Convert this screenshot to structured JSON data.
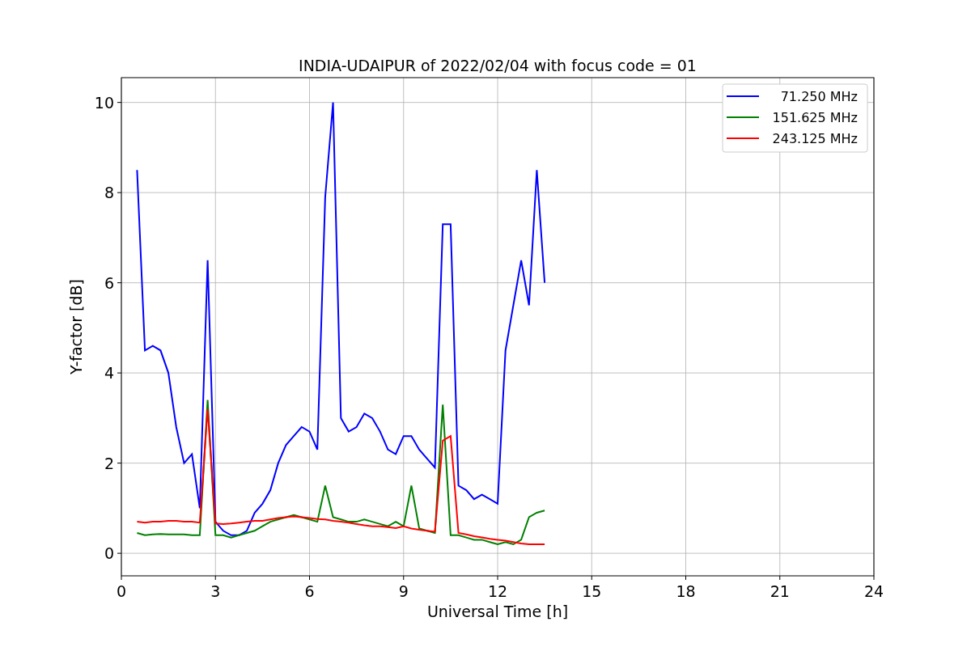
{
  "chart_data": {
    "type": "line",
    "title": "INDIA-UDAIPUR of 2022/02/04 with focus code = 01",
    "xlabel": "Universal Time [h]",
    "ylabel": "Y-factor [dB]",
    "x": [
      0.5,
      0.75,
      1,
      1.25,
      1.5,
      1.75,
      2,
      2.25,
      2.5,
      2.75,
      3,
      3.25,
      3.5,
      3.75,
      4,
      4.25,
      4.5,
      4.75,
      5,
      5.25,
      5.5,
      5.75,
      6,
      6.25,
      6.5,
      6.75,
      7,
      7.25,
      7.5,
      7.75,
      8,
      8.25,
      8.5,
      8.75,
      9,
      9.25,
      9.5,
      9.75,
      10,
      10.25,
      10.5,
      10.75,
      11,
      11.25,
      11.5,
      11.75,
      12,
      12.25,
      12.5,
      12.75,
      13,
      13.25,
      13.5
    ],
    "series": [
      {
        "name": "71.250 MHz",
        "color": "#0000ff",
        "values": [
          8.5,
          4.5,
          4.6,
          4.5,
          4.0,
          2.8,
          2.0,
          2.2,
          1.0,
          6.5,
          0.7,
          0.5,
          0.4,
          0.4,
          0.5,
          0.9,
          1.1,
          1.4,
          2.0,
          2.4,
          2.6,
          2.8,
          2.7,
          2.3,
          7.9,
          10.0,
          3.0,
          2.7,
          2.8,
          3.1,
          3.0,
          2.7,
          2.3,
          2.2,
          2.6,
          2.6,
          2.3,
          2.1,
          1.9,
          7.3,
          7.3,
          1.5,
          1.4,
          1.2,
          1.3,
          1.2,
          1.1,
          4.5,
          5.5,
          6.5,
          5.5,
          8.5,
          6.0
        ]
      },
      {
        "name": "151.625 MHz",
        "color": "#008000",
        "values": [
          0.45,
          0.4,
          0.42,
          0.43,
          0.42,
          0.42,
          0.42,
          0.4,
          0.4,
          3.4,
          0.4,
          0.4,
          0.35,
          0.4,
          0.45,
          0.5,
          0.6,
          0.7,
          0.75,
          0.8,
          0.85,
          0.8,
          0.75,
          0.7,
          1.5,
          0.8,
          0.75,
          0.7,
          0.7,
          0.75,
          0.7,
          0.65,
          0.6,
          0.7,
          0.6,
          1.5,
          0.55,
          0.5,
          0.45,
          3.3,
          0.4,
          0.4,
          0.35,
          0.3,
          0.3,
          0.25,
          0.2,
          0.25,
          0.2,
          0.3,
          0.8,
          0.9,
          0.95
        ]
      },
      {
        "name": "243.125 MHz",
        "color": "#ff0000",
        "values": [
          0.7,
          0.68,
          0.7,
          0.7,
          0.72,
          0.72,
          0.7,
          0.7,
          0.68,
          3.2,
          0.66,
          0.65,
          0.66,
          0.68,
          0.7,
          0.72,
          0.72,
          0.75,
          0.78,
          0.8,
          0.82,
          0.8,
          0.78,
          0.76,
          0.75,
          0.72,
          0.7,
          0.68,
          0.65,
          0.62,
          0.6,
          0.6,
          0.58,
          0.56,
          0.6,
          0.55,
          0.52,
          0.5,
          0.48,
          2.5,
          2.6,
          0.45,
          0.42,
          0.38,
          0.35,
          0.32,
          0.3,
          0.28,
          0.25,
          0.22,
          0.2,
          0.2,
          0.2
        ]
      }
    ],
    "xlim": [
      0,
      24
    ],
    "ylim": [
      -0.5,
      10.55
    ],
    "xticks": [
      0,
      3,
      6,
      9,
      12,
      15,
      18,
      21,
      24
    ],
    "yticks": [
      0,
      2,
      4,
      6,
      8,
      10
    ],
    "grid": true,
    "legend": true
  }
}
